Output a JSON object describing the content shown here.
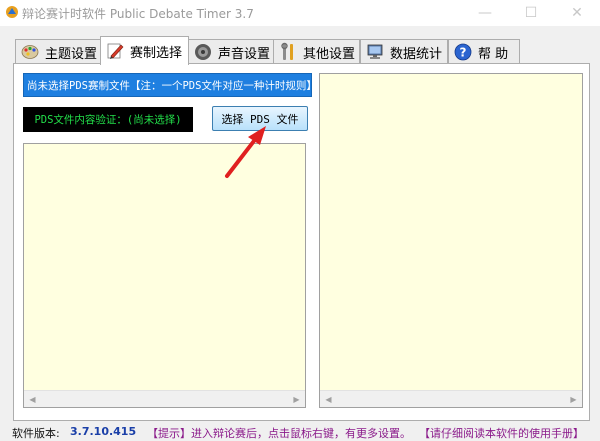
{
  "window": {
    "title": "辩论赛计时软件 Public Debate Timer 3.7",
    "min_glyph": "—",
    "max_glyph": "☐",
    "close_glyph": "✕"
  },
  "tabs": [
    {
      "label": "主题设置",
      "icon": "palette-icon",
      "active": false
    },
    {
      "label": "赛制选择",
      "icon": "pen-icon",
      "active": true
    },
    {
      "label": "声音设置",
      "icon": "speaker-icon",
      "active": false
    },
    {
      "label": "其他设置",
      "icon": "tools-icon",
      "active": false
    },
    {
      "label": "数据统计",
      "icon": "computer-icon",
      "active": false
    },
    {
      "label": "帮 助",
      "icon": "help-icon",
      "active": false
    }
  ],
  "format_panel": {
    "banner_text": "尚未选择PDS赛制文件【注：一个PDS文件对应一种计时规则】",
    "verify_text": "PDS文件内容验证：(尚未选择)",
    "select_button_label": "选择 PDS 文件"
  },
  "status": {
    "version_label": "软件版本:",
    "version": "3.7.10.415",
    "hint": "【提示】进入辩论赛后，点击鼠标右键，有更多设置。",
    "manual": "【请仔细阅读本软件的使用手册】"
  },
  "colors": {
    "banner_bg": "#1e7fe0",
    "verify_fg": "#22e04a",
    "listbox_bg": "#ffffe0",
    "arrow": "#e02020",
    "version_fg": "#1a3fa8",
    "hint_fg": "#8a1a8a"
  }
}
